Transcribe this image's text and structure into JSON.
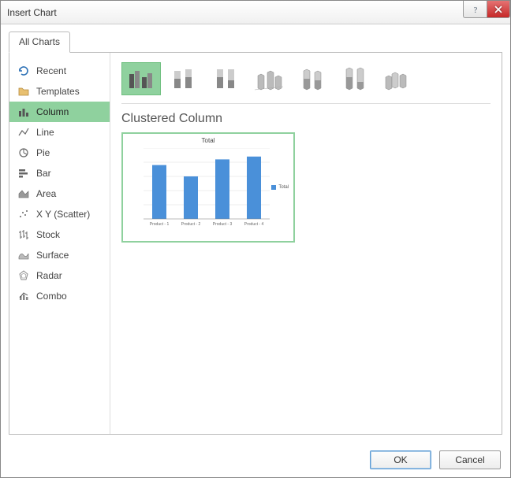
{
  "window": {
    "title": "Insert Chart"
  },
  "tabs": {
    "all_charts": "All Charts"
  },
  "sidebar": {
    "items": [
      {
        "label": "Recent",
        "icon": "recent-icon"
      },
      {
        "label": "Templates",
        "icon": "templates-icon"
      },
      {
        "label": "Column",
        "icon": "column-icon",
        "selected": true
      },
      {
        "label": "Line",
        "icon": "line-icon"
      },
      {
        "label": "Pie",
        "icon": "pie-icon"
      },
      {
        "label": "Bar",
        "icon": "bar-icon"
      },
      {
        "label": "Area",
        "icon": "area-icon"
      },
      {
        "label": "X Y (Scatter)",
        "icon": "scatter-icon"
      },
      {
        "label": "Stock",
        "icon": "stock-icon"
      },
      {
        "label": "Surface",
        "icon": "surface-icon"
      },
      {
        "label": "Radar",
        "icon": "radar-icon"
      },
      {
        "label": "Combo",
        "icon": "combo-icon"
      }
    ]
  },
  "subtypes": [
    {
      "name": "clustered-column",
      "selected": true
    },
    {
      "name": "stacked-column"
    },
    {
      "name": "100-stacked-column"
    },
    {
      "name": "3d-clustered-column"
    },
    {
      "name": "3d-stacked-column"
    },
    {
      "name": "3d-100-stacked-column"
    },
    {
      "name": "3d-column"
    }
  ],
  "selected_subtype_title": "Clustered Column",
  "chart_data": {
    "type": "bar",
    "title": "Total",
    "categories": [
      "Product - 1",
      "Product - 2",
      "Product - 3",
      "Product - 4"
    ],
    "series": [
      {
        "name": "Total",
        "values": [
          1900,
          1500,
          2100,
          2200
        ]
      }
    ],
    "ylabel": "",
    "xlabel": "",
    "ylim": [
      0,
      2500
    ],
    "y_ticks": [
      0,
      500,
      1000,
      1500,
      2000,
      2500
    ],
    "legend": [
      "Total"
    ],
    "colors": {
      "bar": "#4a90d9",
      "accent": "#8fd19e"
    }
  },
  "buttons": {
    "ok": "OK",
    "cancel": "Cancel"
  }
}
